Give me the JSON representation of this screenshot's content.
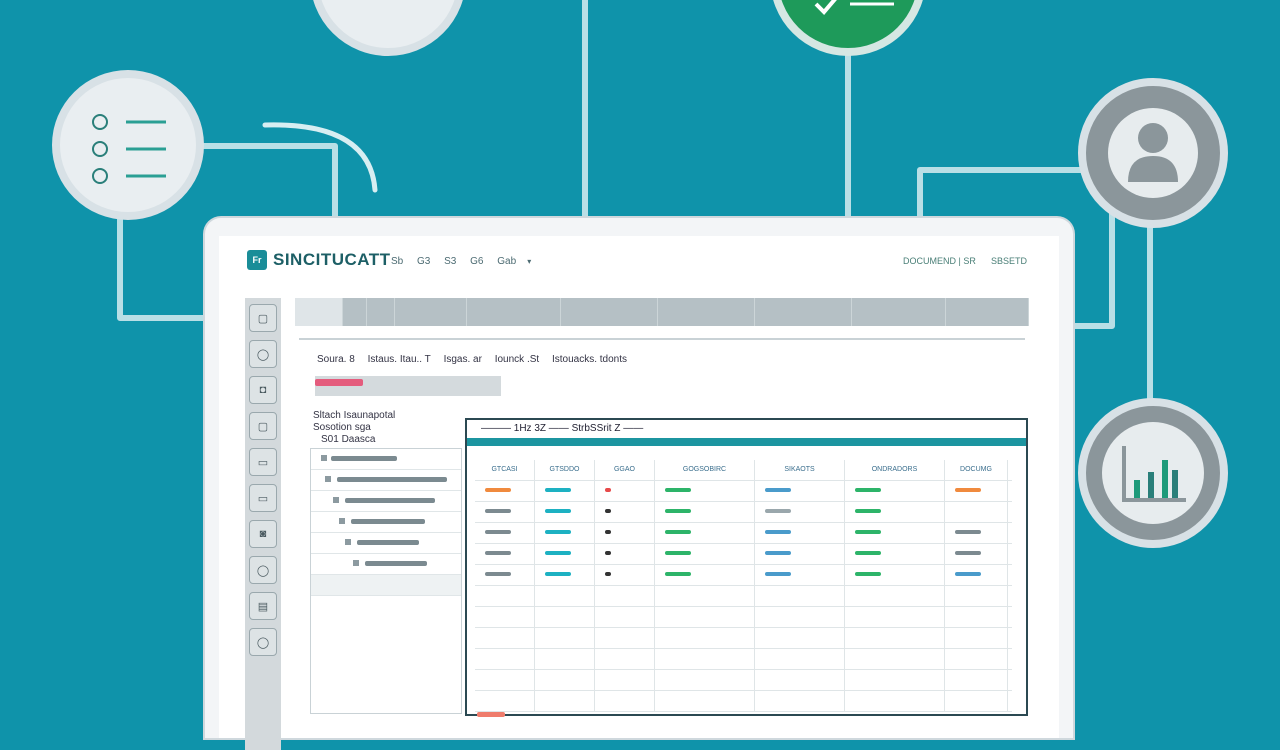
{
  "app": {
    "logo_mark": "Fr",
    "title": "SINCITUCATT",
    "menu": [
      "Sb",
      "G3",
      "S3",
      "G6",
      "Gab"
    ],
    "right_links": [
      "DOCUMEND | SR",
      "SBSETD"
    ]
  },
  "sidebar_icons": [
    "square-icon",
    "circle-icon",
    "camera-icon",
    "square-icon",
    "minus-icon",
    "rect-icon",
    "camera-icon",
    "circle-icon",
    "doc-icon",
    "circle-icon"
  ],
  "filters": {
    "labels": [
      "Soura. 8",
      "Istaus. Itau.. T",
      "Isgas. ar",
      "Iounck .St",
      "Istouacks. tdonts"
    ]
  },
  "left_pane": {
    "title_line1": "Sltach Isaunapotal",
    "title_line2": "Sosotion sga",
    "title_line3": "S01 Daasca"
  },
  "sheet": {
    "title": "——— 1Hz 3Z  ——  StrbSSrit Z  ——",
    "headers": [
      "GTCASI",
      "GTSDDO",
      "GGAO",
      "GOGSOBIRC",
      "SIKAOTS",
      "ONDRADORS",
      "DOCUMG"
    ],
    "row_colors": [
      [
        "#f08a3e",
        "#1db1c2",
        "#e74a4a",
        "#2db469",
        "#4a9bcb",
        "#2db469",
        "#f08a3e"
      ],
      [
        "#7c8a90",
        "#1db1c2",
        "#333333",
        "#2db469",
        "#9aa7ac",
        "#2db469",
        "#ffffff"
      ],
      [
        "#7c8a90",
        "#1db1c2",
        "#333333",
        "#2db469",
        "#4a9bcb",
        "#2db469",
        "#7c8a90"
      ],
      [
        "#7c8a90",
        "#1db1c2",
        "#333333",
        "#2db469",
        "#4a9bcb",
        "#2db469",
        "#7c8a90"
      ],
      [
        "#7c8a90",
        "#1db1c2",
        "#333333",
        "#2db469",
        "#4a9bcb",
        "#2db469",
        "#4a9bcb"
      ]
    ]
  },
  "colors": {
    "background": "#0f93aa",
    "accent": "#1c95a0",
    "check_green": "#1e9a5a"
  }
}
